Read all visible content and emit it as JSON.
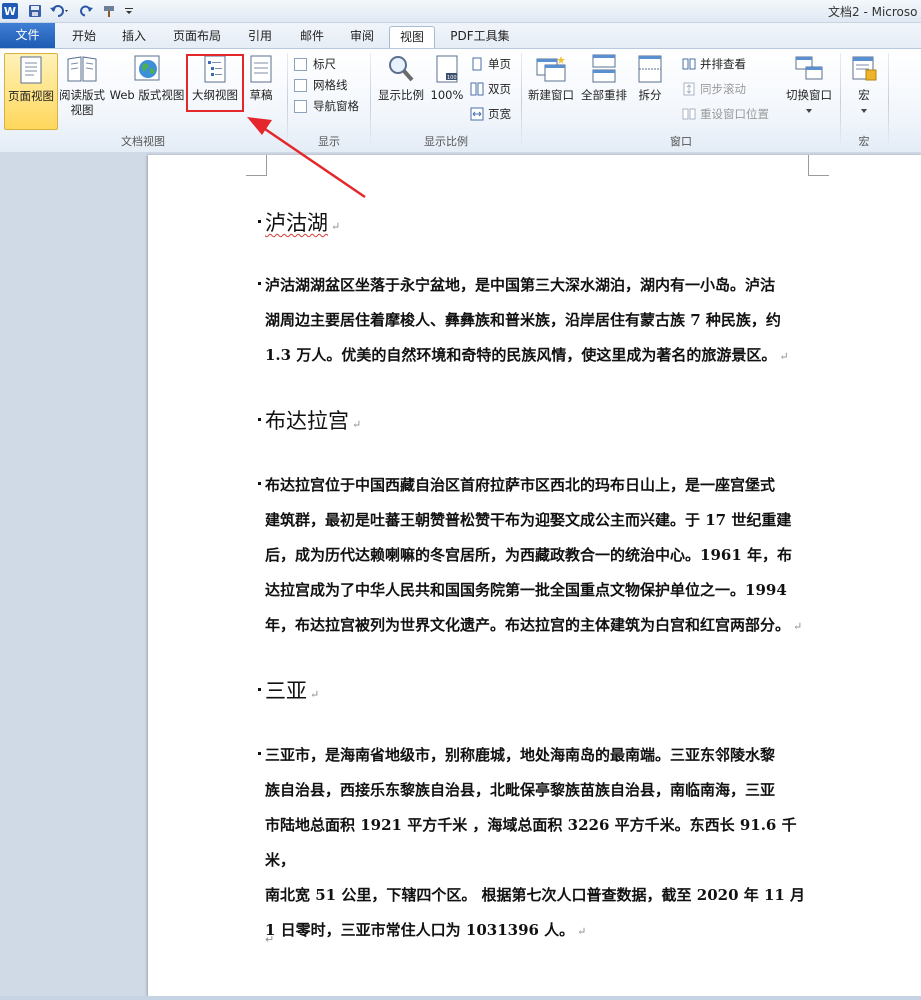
{
  "titlebar": {
    "doc_title": "文档2 - Microso",
    "logo_letter": "W"
  },
  "tabs": [
    {
      "label": "文件"
    },
    {
      "label": "开始"
    },
    {
      "label": "插入"
    },
    {
      "label": "页面布局"
    },
    {
      "label": "引用"
    },
    {
      "label": "邮件"
    },
    {
      "label": "审阅"
    },
    {
      "label": "视图"
    },
    {
      "label": "PDF工具集"
    }
  ],
  "active_tab": "视图",
  "ribbon": {
    "doc_views": {
      "group_label": "文档视图",
      "print_layout": "页面视图",
      "full_reading_1": "阅读版式",
      "full_reading_2": "视图",
      "web_layout": "Web 版式视图",
      "outline": "大纲视图",
      "draft": "草稿"
    },
    "show": {
      "group_label": "显示",
      "ruler": "标尺",
      "gridlines": "网格线",
      "nav_pane": "导航窗格"
    },
    "zoom": {
      "group_label": "显示比例",
      "zoom": "显示比例",
      "hundred": "100%",
      "one_page": "单页",
      "two_pages": "双页",
      "page_width": "页宽"
    },
    "window": {
      "group_label": "窗口",
      "new_window": "新建窗口",
      "arrange_all": "全部重排",
      "split": "拆分",
      "side_by_side": "并排查看",
      "sync_scroll": "同步滚动",
      "reset_pos": "重设窗口位置",
      "switch_window": "切换窗口"
    },
    "macros": {
      "group_label": "宏",
      "macros": "宏"
    }
  },
  "document": {
    "sections": [
      {
        "heading": "泸沽湖",
        "para_lines": [
          "泸沽湖湖盆区坐落于永宁盆地，是中国第三大深水湖泊，湖内有一小岛。泸沽",
          "湖周边主要居住着摩梭人、彝彝族和普米族，沿岸居住有蒙古族 7 种民族，约",
          "1.3 万人。优美的自然环境和奇特的民族风情，使这里成为著名的旅游景区。"
        ]
      },
      {
        "heading": "布达拉宫",
        "para_lines": [
          "布达拉宫位于中国西藏自治区首府拉萨市区西北的玛布日山上，是一座宫堡式",
          "建筑群，最初是吐蕃王朝赞普松赞干布为迎娶文成公主而兴建。于 17 世纪重建",
          "后，成为历代达赖喇嘛的冬宫居所，为西藏政教合一的统治中心。1961 年，布",
          "达拉宫成为了中华人民共和国国务院第一批全国重点文物保护单位之一。1994",
          "年，布达拉宫被列为世界文化遗产。布达拉宫的主体建筑为白宫和红宫两部分。"
        ]
      },
      {
        "heading": "三亚",
        "para_lines": [
          "三亚市，是海南省地级市，别称鹿城，地处海南岛的最南端。三亚东邻陵水黎",
          "族自治县，西接乐东黎族自治县，北毗保亭黎族苗族自治县，南临南海，三亚",
          "市陆地总面积 1921 平方千米 ，海域总面积 3226 平方千米。东西长 91.6 千米，",
          "南北宽 51 公里，下辖四个区。 根据第七次人口普查数据，截至 2020 年 11 月",
          "1 日零时，三亚市常住人口为 1031396 人。"
        ]
      }
    ],
    "para_mark": "↵"
  },
  "colors": {
    "highlight_box": "#e3272b",
    "arrow": "#e3272b",
    "active_view_bg": "#ffd75c"
  }
}
